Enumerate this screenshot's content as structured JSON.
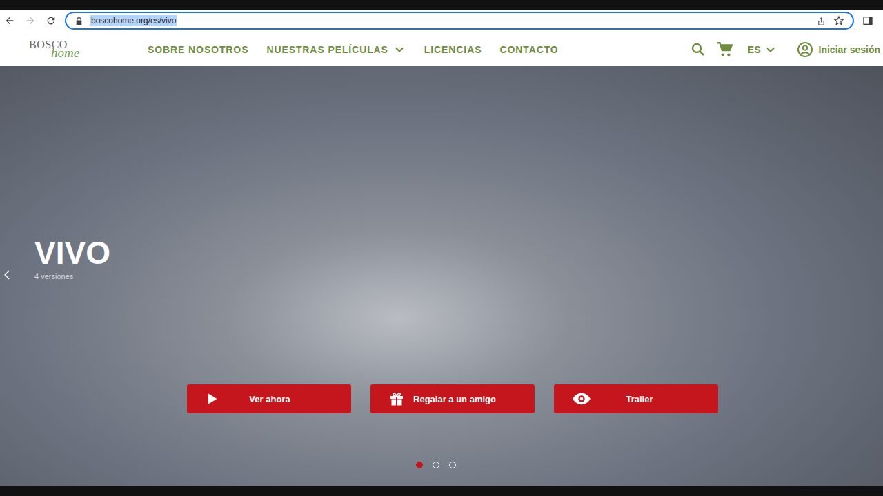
{
  "browser": {
    "url": "boscohome.org/es/vivo",
    "url_selected": true
  },
  "site": {
    "logo": {
      "top": "BOSCO",
      "bottom": "home"
    },
    "nav": [
      {
        "label": "SOBRE NOSOTROS",
        "dropdown": false
      },
      {
        "label": "NUESTRAS PELÍCULAS",
        "dropdown": true
      },
      {
        "label": "LICENCIAS",
        "dropdown": false
      },
      {
        "label": "CONTACTO",
        "dropdown": false
      }
    ],
    "language": "ES",
    "login": "Iniciar sesión"
  },
  "hero": {
    "title": "VIVO",
    "subtitle": "4 versiones",
    "buttons": [
      {
        "label": "Ver ahora",
        "kind": "play"
      },
      {
        "label": "Regalar a un amigo",
        "kind": "gift"
      },
      {
        "label": "Trailer",
        "kind": "eye"
      }
    ],
    "slides": [
      {
        "selected": true
      },
      {
        "selected": false
      },
      {
        "selected": false
      }
    ]
  }
}
